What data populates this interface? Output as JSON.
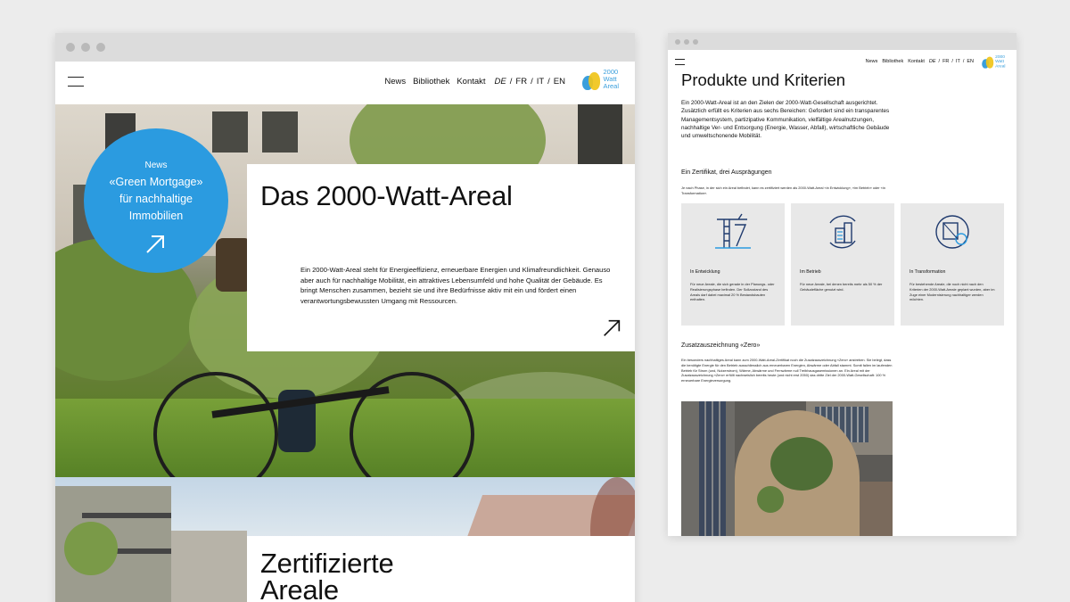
{
  "left_page": {
    "nav": {
      "news": "News",
      "library": "Bibliothek",
      "contact": "Kontakt"
    },
    "languages": [
      "DE",
      "FR",
      "IT",
      "EN"
    ],
    "language_separator": "/",
    "active_language": "DE",
    "logo": {
      "line1": "2000",
      "line2": "Watt",
      "line3": "Areal"
    },
    "badge": {
      "kicker": "News",
      "line1": "«Green Mortgage»",
      "line2": "für nachhaltige",
      "line3": "Immobilien"
    },
    "hero": {
      "title": "Das 2000-Watt-Areal",
      "body": "Ein 2000-Watt-Areal steht für Energieeffizienz, erneuerbare Energien und Klimafreundlichkeit. Genauso aber auch für nachhaltige Mobilität, ein attraktives Lebensumfeld und hohe Qualität der Gebäude. Es bringt Menschen zusammen, bezieht sie und ihre Bedürfnisse aktiv mit ein und fördert einen verantwortungsbewussten Umgang mit Ressourcen."
    },
    "section2": {
      "title_line1": "Zertifizierte",
      "title_line2": "Areale"
    }
  },
  "right_page": {
    "nav": {
      "news": "News",
      "library": "Bibliothek",
      "contact": "Kontakt"
    },
    "languages": [
      "DE",
      "FR",
      "IT",
      "EN"
    ],
    "language_separator": "/",
    "logo": {
      "line1": "2000",
      "line2": "Watt",
      "line3": "Areal"
    },
    "title": "Produkte und Kriterien",
    "intro": "Ein 2000-Watt-Areal ist an den Zielen der 2000-Watt-Gesellschaft ausgerichtet. Zusätzlich erfüllt es Kriterien aus sechs Bereichen: Gefordert sind ein transparentes Managementsystem, partizipative Kommunikation, vielfältige Arealnutzungen, nachhaltige Ver- und Entsorgung (Energie, Wasser, Abfall), wirtschaftliche Gebäude und umweltschonende Mobilität.",
    "certificate_heading": "Ein Zertifikat, drei Ausprägungen",
    "certificate_text": "Je nach Phase, in der sich ein Areal befindet, kann es zertifiziert werden als 2000-Watt-Areal «in Entwicklung», «im Betrieb» oder «in Transformation».",
    "tiles": [
      {
        "icon": "crane-building-icon",
        "title": "In Entwicklung",
        "text": "Für neue Areale, die sich gerade in der Planungs- oder Realisierungsphase befinden. Der Sollzustand des Areals darf dabei maximal 20 % Bestandsbauten enthalten."
      },
      {
        "icon": "buildings-cycle-icon",
        "title": "Im Betrieb",
        "text": "Für neue Areale, bei denen bereits mehr als 50 % der Gebäudefläche genutzt wird."
      },
      {
        "icon": "transformation-icon",
        "title": "In Transformation",
        "text": "Für bestehende Areale, die noch nicht nach den Kriterien der 2000-Watt-Areale geplant wurden, aber im Zuge einer Modernisierung nachhaltiger werden möchten."
      }
    ],
    "zero_heading": "Zusatzauszeichnung «Zero»",
    "zero_text": "Ein besonders nachhaltiges Areal kann zum 2000-Watt-Areal-Zertifikat noch die Zusatzauszeichnung «Zero» anstreben. Sie belegt, dass die benötigte Energie für den Betrieb ausschliesslich aus erneuerbaren Energien, Abwärme oder Abfall stammt. Somit fallen im laufenden Betrieb für Strom (und, Nutzerstrom), Wärme, Abwärme und Fernwärme null Treibhausgasemissionen an. Ein Areal mit der Zusatzauszeichnung «Zero» erfüllt nachweislich bereits heute (und nicht erst 2050) das dritte Ziel der 2000-Watt-Gesellschaft: 100 % erneuerbare Energieversorgung."
  },
  "colors": {
    "brand_blue": "#2b9be0",
    "logo_yellow": "#f0c419",
    "tile_gray": "#e8e8e8",
    "background": "#ececec"
  }
}
